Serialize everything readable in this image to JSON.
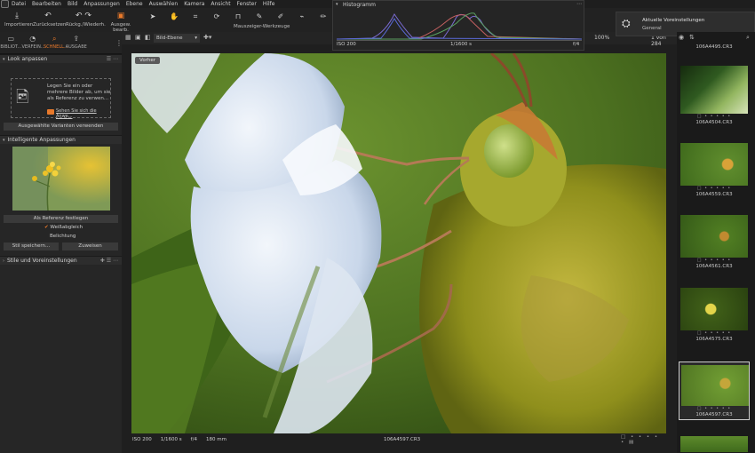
{
  "menu": [
    "Datei",
    "Bearbeiten",
    "Bild",
    "Anpassungen",
    "Ebene",
    "Auswählen",
    "Kamera",
    "Ansicht",
    "Fenster",
    "Hilfe"
  ],
  "toolbar": {
    "import": "Importieren",
    "reset": "Zurücksetzen",
    "undo_redo": "Rückg./Wiederh.",
    "edit_selection": "Ausgew. bearb.",
    "cursor_tools": "Mauszeiger-Werkzeuge"
  },
  "left_tabs": [
    "BIBLIOT...",
    "VERFEIN...",
    "SCHNELL...",
    "AUSGABE"
  ],
  "look": {
    "title": "Look anpassen",
    "drop_text": "Legen Sie ein oder mehrere Bilder ab, um sie als Referenz zu verwen...",
    "video_link": "Sehen Sie sich die Anwe...",
    "use_variants": "Ausgewählte Varianten verwenden"
  },
  "smart": {
    "title": "Intelligente Anpassungen",
    "set_reference": "Als Referenz festlegen",
    "white_balance": "Weißabgleich",
    "exposure": "Belichtung",
    "save": "Stil speichern...",
    "assign": "Zuweisen"
  },
  "styles": {
    "title": "Stile und Voreinstellungen"
  },
  "viewer": {
    "layer_select": "Bild-Ebene",
    "before_label": "Vorher",
    "zoom": "100%",
    "count": "1 von 284"
  },
  "histogram": {
    "title": "Histogramm",
    "iso": "ISO 200",
    "shutter": "1/1600 s",
    "aperture": "f/4"
  },
  "notification": {
    "title": "Aktuelle Voreinstellungen",
    "subtitle": "General"
  },
  "status": {
    "iso": "ISO 200",
    "shutter": "1/1600 s",
    "aperture": "f/4",
    "focal": "180 mm",
    "filename": "106A4597.CR3"
  },
  "thumbs": [
    "106A4495.CR3",
    "106A4504.CR3",
    "106A4559.CR3",
    "106A4561.CR3",
    "106A4575.CR3",
    "106A4597.CR3"
  ]
}
